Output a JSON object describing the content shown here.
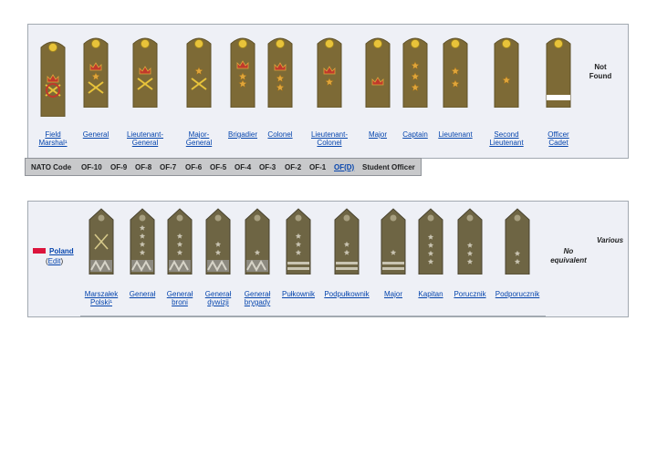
{
  "uk_ranks": [
    {
      "label": "Field\nMarshal¹",
      "insignia": "crown-over-crossed-batons-wreath"
    },
    {
      "label": "General",
      "insignia": "crown-star-crossed-sword-baton"
    },
    {
      "label": "Lieutenant-\nGeneral",
      "insignia": "crown-crossed-sword-baton"
    },
    {
      "label": "Major-\nGeneral",
      "insignia": "star-crossed-sword-baton"
    },
    {
      "label": "Brigadier",
      "insignia": "crown-three-stars"
    },
    {
      "label": "Colonel",
      "insignia": "crown-two-stars"
    },
    {
      "label": "Lieutenant-\nColonel",
      "insignia": "crown-star"
    },
    {
      "label": "Major",
      "insignia": "crown"
    },
    {
      "label": "Captain",
      "insignia": "three-stars"
    },
    {
      "label": "Lieutenant",
      "insignia": "two-stars"
    },
    {
      "label": "Second\nLieutenant",
      "insignia": "one-star"
    },
    {
      "label": "Officer\nCadet",
      "insignia": "white-bar"
    }
  ],
  "not_found": "Not\nFound",
  "nato_codes": [
    {
      "label": "NATO Code",
      "link": false
    },
    {
      "label": "OF-10",
      "link": false
    },
    {
      "label": "OF-9",
      "link": false
    },
    {
      "label": "OF-8",
      "link": false
    },
    {
      "label": "OF-7",
      "link": false
    },
    {
      "label": "OF-6",
      "link": false
    },
    {
      "label": "OF-5",
      "link": false
    },
    {
      "label": "OF-4",
      "link": false
    },
    {
      "label": "OF-3",
      "link": false
    },
    {
      "label": "OF-2",
      "link": false
    },
    {
      "label": "OF-1",
      "link": false
    },
    {
      "label": "OF(D)",
      "link": true
    },
    {
      "label": "Student Officer",
      "link": false
    }
  ],
  "poland": {
    "country": "Poland",
    "edit_prefix": "(",
    "edit": "Edit",
    "edit_suffix": ")",
    "no_equivalent": "No\nequivalent",
    "various": "Various",
    "ranks": [
      {
        "label": "Marszałek\nPolski¹",
        "stars": 0,
        "zigzag": true,
        "bars": 0,
        "batons": true
      },
      {
        "label": "Generał",
        "stars": 4,
        "zigzag": true,
        "bars": 0,
        "batons": false
      },
      {
        "label": "Generał\nbroni",
        "stars": 3,
        "zigzag": true,
        "bars": 0,
        "batons": false
      },
      {
        "label": "Generał\ndywizji",
        "stars": 2,
        "zigzag": true,
        "bars": 0,
        "batons": false
      },
      {
        "label": "Generał\nbrygady",
        "stars": 1,
        "zigzag": true,
        "bars": 0,
        "batons": false
      },
      {
        "label": "Pułkownik",
        "stars": 3,
        "zigzag": false,
        "bars": 2,
        "batons": false
      },
      {
        "label": "Podpułkownik",
        "stars": 2,
        "zigzag": false,
        "bars": 2,
        "batons": false
      },
      {
        "label": "Major",
        "stars": 1,
        "zigzag": false,
        "bars": 2,
        "batons": false
      },
      {
        "label": "Kapitan",
        "stars": 4,
        "zigzag": false,
        "bars": 0,
        "batons": false
      },
      {
        "label": "Porucznik",
        "stars": 3,
        "zigzag": false,
        "bars": 0,
        "batons": false
      },
      {
        "label": "Podporucznik",
        "stars": 2,
        "zigzag": false,
        "bars": 0,
        "batons": false
      }
    ]
  },
  "colors": {
    "strap": "#7d6a36",
    "strap_dark": "#5f5128",
    "button": "#e8c33a",
    "star": "#e0a53a",
    "crown": "#c0392b",
    "pl_strap": "#6e6544",
    "pl_star": "#c9c4b2"
  }
}
